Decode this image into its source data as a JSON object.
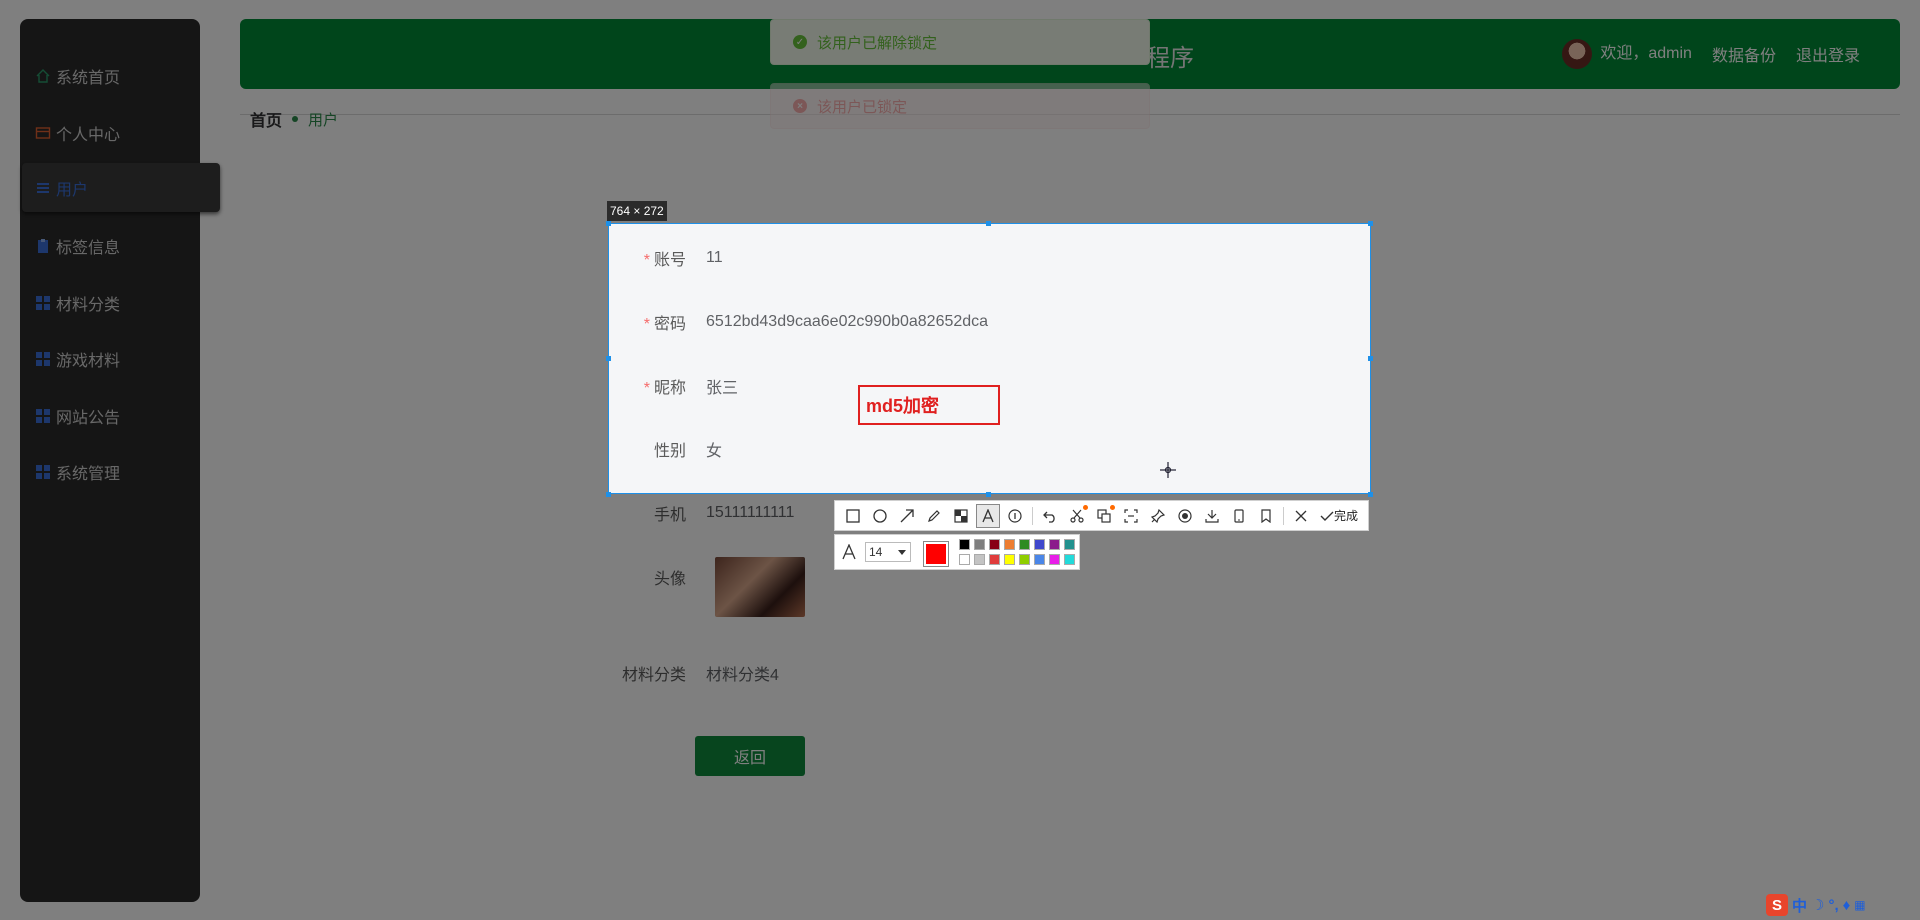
{
  "sidebar": {
    "items": [
      {
        "label": "系统首页",
        "icon": "home-icon"
      },
      {
        "label": "个人中心",
        "icon": "card-icon"
      },
      {
        "label": "用户",
        "icon": "menu-list-icon"
      },
      {
        "label": "标签信息",
        "icon": "clipboard-icon"
      },
      {
        "label": "材料分类",
        "icon": "grid-icon"
      },
      {
        "label": "游戏材料",
        "icon": "grid-icon"
      },
      {
        "label": "网站公告",
        "icon": "grid-icon"
      },
      {
        "label": "系统管理",
        "icon": "grid-icon"
      }
    ],
    "active_index": 2
  },
  "header": {
    "title_visible": "程序",
    "welcome": "欢迎，admin",
    "backup": "数据备份",
    "logout": "退出登录"
  },
  "breadcrumb": {
    "home": "首页",
    "current": "用户"
  },
  "toasts": [
    {
      "type": "success",
      "text": "该用户已解除锁定"
    },
    {
      "type": "error",
      "text": "该用户已锁定"
    }
  ],
  "form": {
    "account": {
      "label": "账号",
      "value": "11"
    },
    "password": {
      "label": "密码",
      "value": "6512bd43d9caa6e02c990b0a82652dca"
    },
    "nickname": {
      "label": "昵称",
      "value": "张三"
    },
    "gender": {
      "label": "性别",
      "value": "女"
    },
    "phone": {
      "label": "手机",
      "value": "15111111111"
    },
    "avatar": {
      "label": "头像"
    },
    "category": {
      "label": "材料分类",
      "value": "材料分类4"
    },
    "back_button": "返回"
  },
  "screenshot_tool": {
    "size_label": "764 × 272",
    "annotation_text": "md5加密",
    "done_label": "完成",
    "font_size": "14",
    "current_color": "#ff0000",
    "palette": [
      "#000000",
      "#7f7f7f",
      "#880015",
      "#ed7d31",
      "#2e8b22",
      "#3f48cc",
      "#8b1a8b",
      "#22918e",
      "#ffffff",
      "#c3c3c3",
      "#e03c3c",
      "#ffff00",
      "#8fce00",
      "#4a86e8",
      "#e81ee8",
      "#22dada"
    ]
  },
  "tray": {
    "ime": "中"
  },
  "colors": {
    "header": "#008a36",
    "accent": "#2a8a4a",
    "danger": "#f56c6c",
    "success": "#67c23a",
    "selection": "#1e90e8"
  }
}
